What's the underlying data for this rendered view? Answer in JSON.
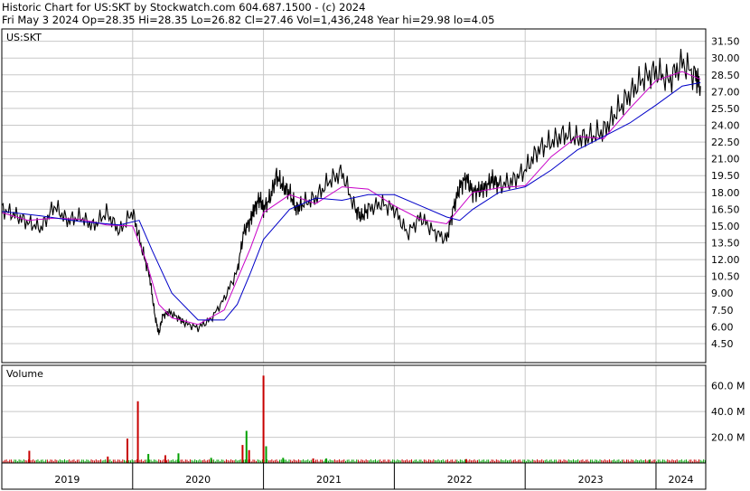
{
  "header": {
    "line1": "Historic Chart for US:SKT by Stockwatch.com 604.687.1500 - (c) 2024",
    "line2": "Fri May  3 2024  Op=28.35  Hi=28.35  Lo=26.82  Cl=27.46  Vol=1,436,248  Year hi=29.98  lo=4.05"
  },
  "chart_data": [
    {
      "type": "line",
      "title": "US:SKT",
      "ylim": [
        2.8,
        32.6
      ],
      "y_tick_labels": [
        "31.50",
        "30.00",
        "28.50",
        "27.00",
        "25.50",
        "24.00",
        "22.50",
        "21.00",
        "19.50",
        "18.00",
        "16.50",
        "15.00",
        "13.50",
        "12.00",
        "10.50",
        "9.00",
        "7.50",
        "6.00",
        "4.50"
      ],
      "x_tick_labels": [
        "2019",
        "2020",
        "2021",
        "2022",
        "2023",
        "2024"
      ],
      "grid": true,
      "series": [
        {
          "color": "#000000",
          "x": [
            2019.0,
            2019.1,
            2019.2,
            2019.3,
            2019.4,
            2019.5,
            2019.6,
            2019.7,
            2019.8,
            2019.9,
            2020.0,
            2020.07,
            2020.13,
            2020.17,
            2020.2,
            2020.23,
            2020.28,
            2020.35,
            2020.4,
            2020.5,
            2020.6,
            2020.7,
            2020.8,
            2020.85,
            2020.9,
            2020.93,
            2020.97,
            2021.0,
            2021.05,
            2021.1,
            2021.15,
            2021.2,
            2021.25,
            2021.3,
            2021.4,
            2021.5,
            2021.6,
            2021.7,
            2021.75,
            2021.8,
            2021.9,
            2022.0,
            2022.1,
            2022.2,
            2022.3,
            2022.4,
            2022.45,
            2022.5,
            2022.55,
            2022.6,
            2022.65,
            2022.7,
            2022.75,
            2022.8,
            2022.9,
            2023.0,
            2023.1,
            2023.2,
            2023.3,
            2023.4,
            2023.5,
            2023.6,
            2023.7,
            2023.8,
            2023.9,
            2024.0,
            2024.1,
            2024.2,
            2024.3,
            2024.34
          ],
          "values": [
            16.5,
            16.0,
            15.3,
            14.8,
            16.8,
            15.5,
            15.8,
            15.0,
            16.2,
            14.5,
            16.3,
            13.0,
            10.5,
            7.0,
            5.4,
            7.0,
            7.3,
            6.8,
            6.3,
            5.9,
            6.7,
            8.5,
            11.0,
            14.5,
            15.5,
            16.5,
            17.5,
            16.5,
            17.5,
            19.5,
            18.5,
            18.0,
            16.5,
            17.0,
            17.5,
            19.0,
            19.8,
            16.5,
            15.8,
            16.5,
            17.0,
            16.5,
            14.3,
            15.8,
            14.5,
            13.8,
            16.5,
            18.5,
            19.3,
            18.0,
            18.2,
            18.5,
            19.2,
            18.6,
            19.0,
            20.0,
            21.8,
            22.5,
            23.2,
            22.8,
            23.0,
            23.5,
            25.2,
            26.8,
            28.2,
            28.8,
            28.0,
            29.6,
            28.4,
            27.5
          ]
        },
        {
          "color": "#c800c8",
          "x": [
            2019.0,
            2019.2,
            2019.4,
            2019.6,
            2019.8,
            2020.0,
            2020.1,
            2020.2,
            2020.3,
            2020.5,
            2020.7,
            2020.9,
            2021.0,
            2021.2,
            2021.4,
            2021.6,
            2021.8,
            2022.0,
            2022.2,
            2022.4,
            2022.6,
            2022.8,
            2023.0,
            2023.2,
            2023.4,
            2023.6,
            2023.8,
            2024.0,
            2024.2,
            2024.34
          ],
          "values": [
            16.2,
            15.5,
            15.7,
            15.6,
            15.1,
            15.0,
            12.0,
            8.0,
            6.8,
            6.2,
            7.5,
            13.0,
            16.2,
            17.8,
            17.0,
            18.5,
            18.3,
            16.8,
            15.6,
            15.2,
            18.0,
            18.4,
            18.6,
            21.2,
            23.0,
            22.8,
            25.5,
            28.0,
            28.8,
            28.1
          ]
        },
        {
          "color": "#0000c8",
          "x": [
            2019.0,
            2019.3,
            2019.6,
            2019.9,
            2020.05,
            2020.15,
            2020.3,
            2020.5,
            2020.7,
            2020.8,
            2020.9,
            2021.0,
            2021.2,
            2021.4,
            2021.6,
            2021.8,
            2022.0,
            2022.2,
            2022.4,
            2022.5,
            2022.6,
            2022.8,
            2023.0,
            2023.2,
            2023.4,
            2023.6,
            2023.8,
            2024.0,
            2024.2,
            2024.34
          ],
          "values": [
            16.3,
            15.9,
            15.4,
            15.1,
            15.5,
            12.8,
            9.0,
            6.6,
            6.6,
            8.0,
            10.8,
            13.8,
            16.5,
            17.5,
            17.3,
            17.8,
            17.8,
            16.8,
            15.8,
            15.5,
            16.5,
            18.0,
            18.5,
            20.0,
            21.8,
            23.0,
            24.2,
            25.8,
            27.5,
            27.8
          ]
        }
      ]
    },
    {
      "type": "bar",
      "title": "Volume",
      "ylim": [
        0,
        76.0
      ],
      "y_tick_labels": [
        "60.0 M",
        "40.0 M",
        "20.0 M"
      ],
      "spikes": [
        {
          "x": 2019.21,
          "value": 9.5,
          "color": "#c80000"
        },
        {
          "x": 2019.81,
          "value": 5.0,
          "color": "#c80000"
        },
        {
          "x": 2019.96,
          "value": 19.0,
          "color": "#c80000"
        },
        {
          "x": 2020.04,
          "value": 48.0,
          "color": "#c80000"
        },
        {
          "x": 2020.12,
          "value": 7.0,
          "color": "#00a000"
        },
        {
          "x": 2020.25,
          "value": 6.0,
          "color": "#c80000"
        },
        {
          "x": 2020.35,
          "value": 7.5,
          "color": "#00a000"
        },
        {
          "x": 2020.6,
          "value": 4.0,
          "color": "#00a000"
        },
        {
          "x": 2020.84,
          "value": 14.0,
          "color": "#c80000"
        },
        {
          "x": 2020.87,
          "value": 25.0,
          "color": "#00a000"
        },
        {
          "x": 2020.89,
          "value": 10.0,
          "color": "#c80000"
        },
        {
          "x": 2021.0,
          "value": 68.0,
          "color": "#c80000"
        },
        {
          "x": 2021.02,
          "value": 13.0,
          "color": "#00a000"
        },
        {
          "x": 2021.15,
          "value": 4.0,
          "color": "#00a000"
        },
        {
          "x": 2021.38,
          "value": 3.5,
          "color": "#c80000"
        },
        {
          "x": 2021.48,
          "value": 3.5,
          "color": "#00a000"
        },
        {
          "x": 2022.55,
          "value": 3.0,
          "color": "#c80000"
        },
        {
          "x": 2023.95,
          "value": 2.5,
          "color": "#00a000"
        }
      ]
    }
  ]
}
